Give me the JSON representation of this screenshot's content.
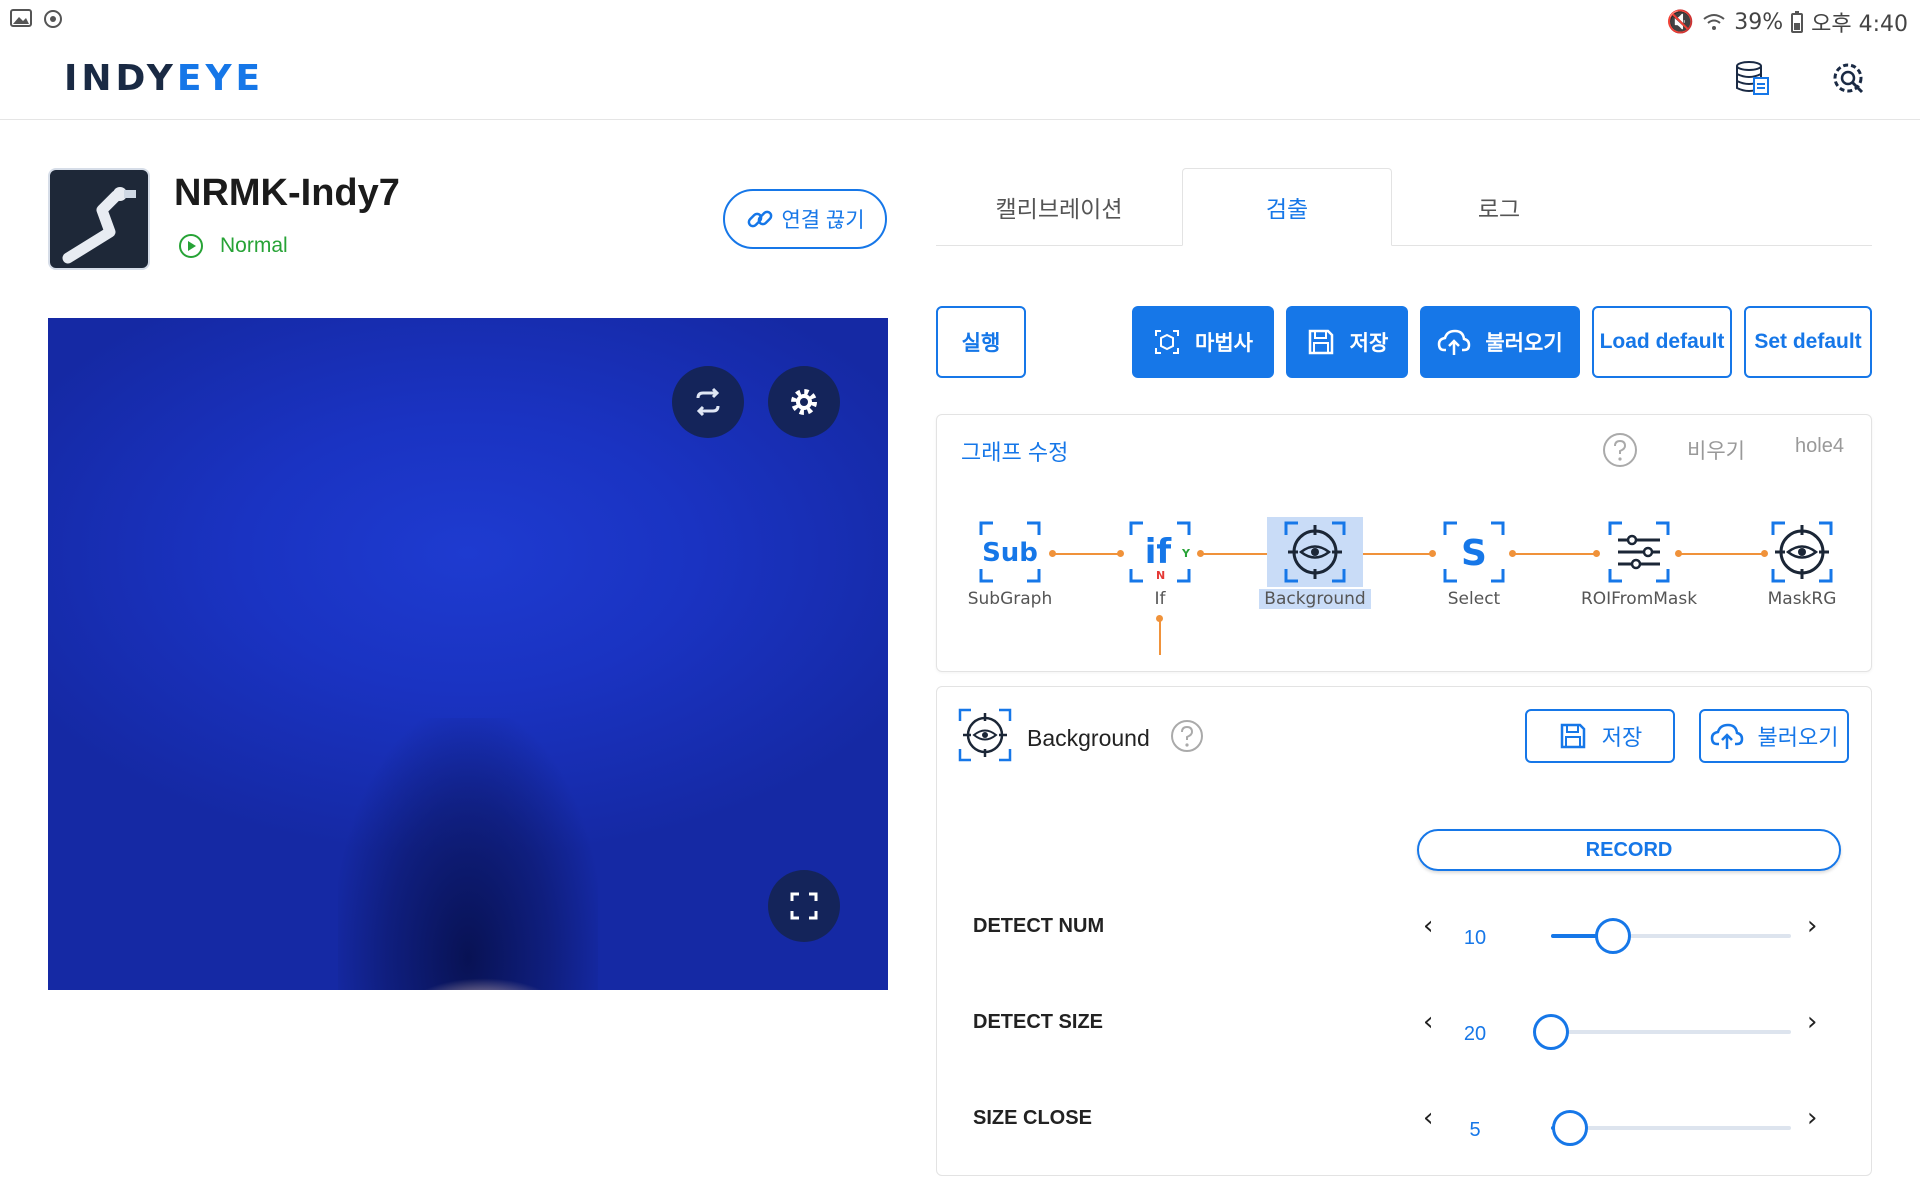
{
  "status_bar": {
    "battery_text": "39%",
    "time_text": "오후 4:40"
  },
  "header": {
    "logo_part1": "INDY",
    "logo_part2": "EYE"
  },
  "robot": {
    "name": "NRMK-Indy7",
    "status": "Normal",
    "disconnect_label": "연결 끊기"
  },
  "tabs": [
    {
      "label": "캘리브레이션",
      "active": false
    },
    {
      "label": "검출",
      "active": true
    },
    {
      "label": "로그",
      "active": false
    }
  ],
  "actions": {
    "run": "실행",
    "wizard": "마법사",
    "save": "저장",
    "load": "불러오기",
    "load_default": "Load default",
    "set_default": "Set default"
  },
  "graph": {
    "title": "그래프 수정",
    "clear_label": "비우기",
    "graph_name": "hole4",
    "nodes": [
      {
        "label": "SubGraph",
        "icon": "sub-icon",
        "icon_text": "Sub"
      },
      {
        "label": "If",
        "icon": "if-icon",
        "icon_text": "if",
        "yes": "Y",
        "no": "N"
      },
      {
        "label": "Background",
        "icon": "target-eye-icon",
        "selected": true
      },
      {
        "label": "Select",
        "icon": "select-icon",
        "icon_text": "S"
      },
      {
        "label": "ROIFromMask",
        "icon": "sliders-icon"
      },
      {
        "label": "MaskRG",
        "icon": "target-eye-icon"
      }
    ]
  },
  "node_panel": {
    "title": "Background",
    "save_label": "저장",
    "load_label": "불러오기",
    "record_label": "RECORD",
    "params": [
      {
        "label": "DETECT NUM",
        "value": "10",
        "fraction": 0.26
      },
      {
        "label": "DETECT SIZE",
        "value": "20",
        "fraction": 0.0
      },
      {
        "label": "SIZE CLOSE",
        "value": "5",
        "fraction": 0.08
      }
    ]
  },
  "colors": {
    "accent": "#1677e8",
    "status_green": "#27a336",
    "edge_orange": "#f0923a",
    "camera_blue": "#1a33c2"
  }
}
